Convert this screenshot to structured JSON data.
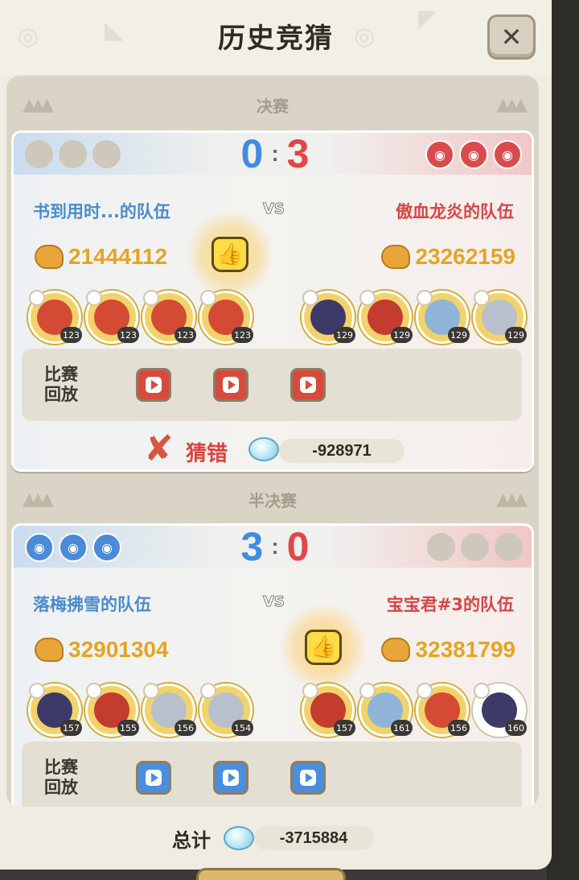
{
  "title": "历史竞猜",
  "close_label": "✕",
  "matches": [
    {
      "stage": "决赛",
      "score_left": "0",
      "score_right": "3",
      "score_sep": ":",
      "team_left": "书到用时...的队伍",
      "team_right": "傲血龙炎的队伍",
      "vs": "VS",
      "power_left": "21444112",
      "power_right": "23262159",
      "heroes_left": [
        "123",
        "123",
        "123",
        "123"
      ],
      "heroes_right": [
        "129",
        "129",
        "129",
        "129"
      ],
      "replay_label_1": "比赛",
      "replay_label_2": "回放",
      "result_text": "猜错",
      "result_amount": "-928971"
    },
    {
      "stage": "半决赛",
      "score_left": "3",
      "score_right": "0",
      "score_sep": ":",
      "team_left": "落梅拂雪的队伍",
      "team_right": "宝宝君#3的队伍",
      "vs": "VS",
      "power_left": "32901304",
      "power_right": "32381799",
      "heroes_left": [
        "157",
        "155",
        "156",
        "154"
      ],
      "heroes_right": [
        "157",
        "161",
        "156",
        "160"
      ],
      "replay_label_1": "比赛",
      "replay_label_2": "回放"
    }
  ],
  "total_label": "总计",
  "total_amount": "-3715884",
  "colors": {
    "blue_team": "#3f8de2",
    "red_team": "#e24646",
    "power": "#e5a423"
  },
  "icons": [
    "close-icon",
    "thumbs-up-icon",
    "arm-power-icon",
    "play-icon",
    "wrong-x-icon",
    "diamond-gem-icon"
  ]
}
